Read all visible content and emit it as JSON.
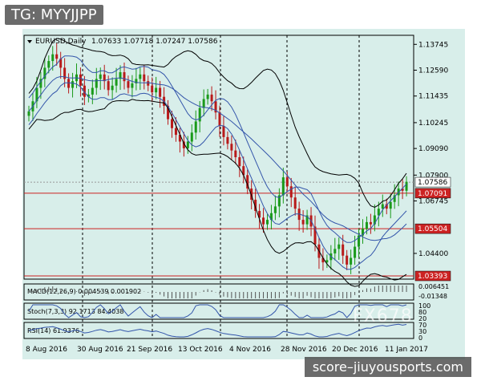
{
  "tag": "TG: MYYJJPP",
  "watermark": "score–jiuyousports.com",
  "fx_watermark": "FX678",
  "chart_header": {
    "symbol": "EURUSD,Daily",
    "ohlc": "1.07633 1.07718 1.07247 1.07586"
  },
  "panels": {
    "macd": "MACD(12,26,9) 0.004539 0.001902",
    "stoch": "Stoch(7,3,3) 92.1713 84.4038",
    "rsi": "RSI(14) 61.9376"
  },
  "price_axis_ticks": [
    "1.13745",
    "1.12590",
    "1.11435",
    "1.10245",
    "1.09090",
    "1.07900",
    "1.06745",
    "1.04400"
  ],
  "price_markers": [
    {
      "text": "1.07586",
      "color": "#000000",
      "bg": "#ffffff"
    },
    {
      "text": "1.07091",
      "color": "#ffffff",
      "bg": "#cc2222"
    },
    {
      "text": "1.05504",
      "color": "#ffffff",
      "bg": "#cc2222"
    },
    {
      "text": "1.03393",
      "color": "#ffffff",
      "bg": "#cc2222"
    }
  ],
  "sub_axis": {
    "macd_top": "0.006451",
    "macd_bottom": "-0.01348",
    "stoch_top": "100",
    "stoch_mid": "80",
    "stoch_bottom": "20",
    "rsi_top": "70",
    "rsi_bottom": "30",
    "rsi_zero": "0"
  },
  "date_labels": [
    "8 Aug 2016",
    "30 Aug 2016",
    "21 Sep 2016",
    "13 Oct 2016",
    "4 Nov 2016",
    "28 Nov 2016",
    "20 Dec 2016",
    "11 Jan 2017"
  ],
  "chart_data": {
    "type": "candlestick",
    "instrument": "EURUSD",
    "timeframe": "Daily",
    "x_range": [
      "8 Aug 2016",
      "11 Jan 2017"
    ],
    "y_range": [
      1.0325,
      1.1415
    ],
    "horizontal_lines": [
      1.07091,
      1.05504,
      1.03393
    ],
    "last_ohlc": {
      "open": 1.07633,
      "high": 1.07718,
      "low": 1.07247,
      "close": 1.07586
    },
    "closes": [
      1.1075,
      1.112,
      1.118,
      1.122,
      1.127,
      1.13,
      1.133,
      1.131,
      1.127,
      1.122,
      1.118,
      1.121,
      1.124,
      1.119,
      1.114,
      1.115,
      1.118,
      1.122,
      1.124,
      1.121,
      1.117,
      1.119,
      1.122,
      1.125,
      1.121,
      1.118,
      1.12,
      1.122,
      1.124,
      1.121,
      1.119,
      1.116,
      1.118,
      1.114,
      1.11,
      1.104,
      1.1,
      1.097,
      1.094,
      1.091,
      1.094,
      1.098,
      1.103,
      1.109,
      1.113,
      1.115,
      1.112,
      1.107,
      1.101,
      1.096,
      1.093,
      1.09,
      1.087,
      1.083,
      1.079,
      1.073,
      1.068,
      1.063,
      1.06,
      1.057,
      1.059,
      1.062,
      1.065,
      1.07,
      1.078,
      1.074,
      1.069,
      1.064,
      1.059,
      1.057,
      1.061,
      1.056,
      1.048,
      1.042,
      1.04,
      1.041,
      1.044,
      1.046,
      1.048,
      1.043,
      1.039,
      1.042,
      1.047,
      1.052,
      1.055,
      1.058,
      1.057,
      1.061,
      1.064,
      1.066,
      1.064,
      1.067,
      1.07,
      1.073,
      1.072,
      1.076
    ],
    "bollinger_note": "upper/middle/lower bands shown"
  }
}
